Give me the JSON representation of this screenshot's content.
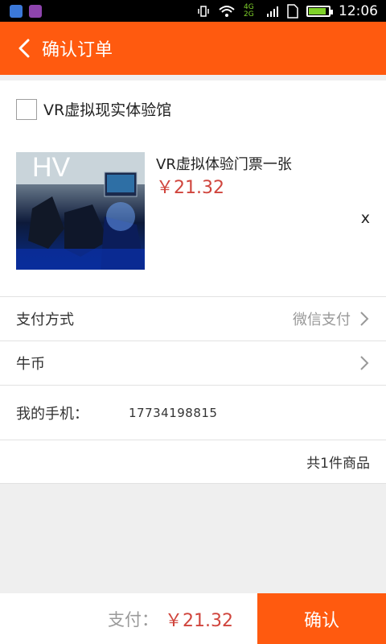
{
  "status_bar": {
    "time": "12:06",
    "network": "4G 2G",
    "icons": [
      "app-shield-icon",
      "app-photo-icon",
      "vibrate-icon",
      "wifi-icon",
      "signal-icon",
      "sim-icon",
      "battery-icon"
    ],
    "battery_color": "#7fd12a"
  },
  "header": {
    "title": "确认订单",
    "back_icon": "chevron-left-icon",
    "bg_color": "#ff5a0f"
  },
  "shop": {
    "name": "VR虚拟现实体验馆"
  },
  "product": {
    "title": "VR虚拟体验门票一张",
    "price": "￥21.32",
    "remove": "x",
    "image": "vr-experience-photo"
  },
  "rows": {
    "payment": {
      "label": "支付方式",
      "value": "微信支付"
    },
    "coins": {
      "label": "牛币",
      "value": ""
    },
    "phone": {
      "label": "我的手机：",
      "value": "17734198815"
    },
    "count": {
      "text": "共1件商品"
    }
  },
  "footer": {
    "pay_label": "支付：",
    "pay_amount": "￥21.32",
    "confirm": "确认"
  }
}
